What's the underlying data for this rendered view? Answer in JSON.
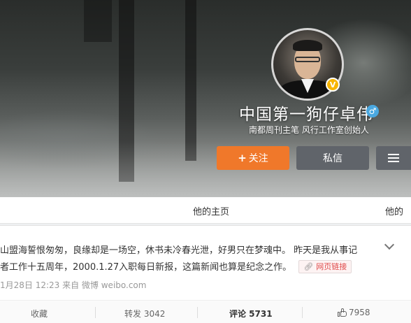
{
  "profile": {
    "nickname": "中国第一狗仔卓伟",
    "gender_icon": "♂",
    "verified_badge": "V",
    "bio": "南都周刊主笔 风行工作室创始人",
    "follow_button": "关注",
    "follow_plus": "+",
    "message_button": "私信"
  },
  "tabs": {
    "home": "他的主页",
    "other": "他的"
  },
  "post": {
    "text_line1": "山盟海誓恨匆匆，良缘却是一场空，休书未冷春光泄，好男只在梦魂中。 昨天是我从事记",
    "text_line2": "者工作十五周年，2000.1.27入职每日新报，这篇新闻也算是纪念之作。",
    "link_label": "网页链接",
    "meta": "1月28日 12:23 来自 微博 weibo.com"
  },
  "actions": {
    "favorite": "收藏",
    "repost": "转发 3042",
    "comment": "评论 5731",
    "like": "7958"
  },
  "colors": {
    "follow": "#f0782a",
    "secondary_button": "#60646a",
    "verified": "#f7b500",
    "gender": "#4aa8e0"
  }
}
